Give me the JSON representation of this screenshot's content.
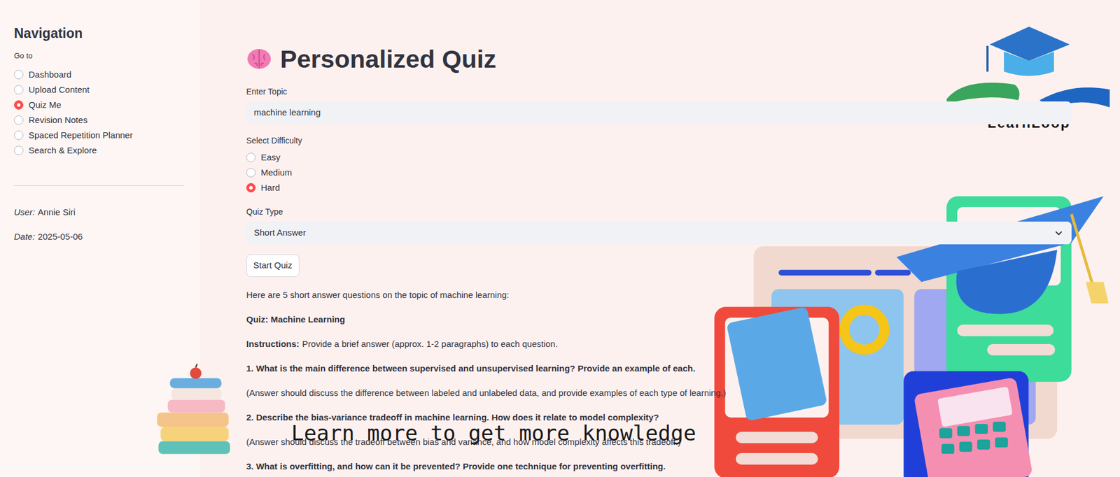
{
  "sidebar": {
    "title": "Navigation",
    "label": "Go to",
    "items": [
      {
        "label": "Dashboard",
        "selected": false
      },
      {
        "label": "Upload Content",
        "selected": false
      },
      {
        "label": "Quiz Me",
        "selected": true
      },
      {
        "label": "Revision Notes",
        "selected": false
      },
      {
        "label": "Spaced Repetition Planner",
        "selected": false
      },
      {
        "label": "Search & Explore",
        "selected": false
      }
    ],
    "user": {
      "label": "User:",
      "value": "Annie Siri"
    },
    "date": {
      "label": "Date:",
      "value": "2025-05-06"
    }
  },
  "header": {
    "title": "Personalized Quiz"
  },
  "logo": {
    "text": "LearnLoop"
  },
  "form": {
    "topic": {
      "label": "Enter Topic",
      "value": "machine learning"
    },
    "difficulty": {
      "label": "Select Difficulty",
      "options": [
        {
          "label": "Easy",
          "selected": false
        },
        {
          "label": "Medium",
          "selected": false
        },
        {
          "label": "Hard",
          "selected": true
        }
      ]
    },
    "quiz_type": {
      "label": "Quiz Type",
      "value": "Short Answer"
    },
    "button": "Start Quiz"
  },
  "output": {
    "intro": "Here are 5 short answer questions on the topic of machine learning:",
    "heading": "Quiz: Machine Learning",
    "instructions": {
      "label": "Instructions:",
      "text": "Provide a brief answer (approx. 1-2 paragraphs) to each question."
    },
    "questions": [
      {
        "question": "1. What is the main difference between supervised and unsupervised learning? Provide an example of each.",
        "hint": "(Answer should discuss the difference between labeled and unlabeled data, and provide examples of each type of learning.)"
      },
      {
        "question": "2. Describe the bias-variance tradeoff in machine learning. How does it relate to model complexity?",
        "hint": "(Answer should discuss the tradeoff between bias and variance, and how model complexity affects this tradeoff.)"
      },
      {
        "question": "3. What is overfitting, and how can it be prevented? Provide one technique for preventing overfitting.",
        "hint": ""
      }
    ]
  },
  "overlay": {
    "slogan": "Learn more to get more knowledge"
  }
}
